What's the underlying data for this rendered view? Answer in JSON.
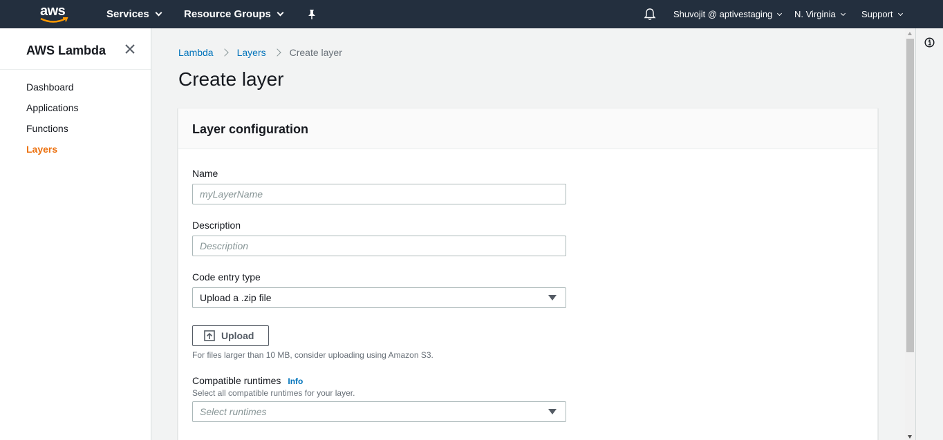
{
  "topnav": {
    "logo_text": "aws",
    "services_label": "Services",
    "resource_groups_label": "Resource Groups",
    "account_label": "Shuvojit @ aptivestaging",
    "region_label": "N. Virginia",
    "support_label": "Support",
    "pin_icon": "pushpin-icon",
    "bell_icon": "bell-icon"
  },
  "sidebar": {
    "title": "AWS Lambda",
    "close_icon": "close-icon",
    "items": [
      {
        "label": "Dashboard",
        "active": false
      },
      {
        "label": "Applications",
        "active": false
      },
      {
        "label": "Functions",
        "active": false
      },
      {
        "label": "Layers",
        "active": true
      }
    ]
  },
  "breadcrumb": {
    "items": [
      "Lambda",
      "Layers"
    ],
    "current": "Create layer"
  },
  "page": {
    "title": "Create layer"
  },
  "panel": {
    "title": "Layer configuration",
    "name": {
      "label": "Name",
      "placeholder": "myLayerName",
      "value": ""
    },
    "description": {
      "label": "Description",
      "placeholder": "Description",
      "value": ""
    },
    "code_entry": {
      "label": "Code entry type",
      "selected": "Upload a .zip file"
    },
    "upload": {
      "button_label": "Upload",
      "hint": "For files larger than 10 MB, consider uploading using Amazon S3."
    },
    "runtimes": {
      "label": "Compatible runtimes",
      "info_label": "Info",
      "hint": "Select all compatible runtimes for your layer.",
      "placeholder": "Select runtimes"
    }
  },
  "colors": {
    "nav_bg": "#232f3e",
    "accent_orange": "#ec7211",
    "link_blue": "#0073bb"
  }
}
